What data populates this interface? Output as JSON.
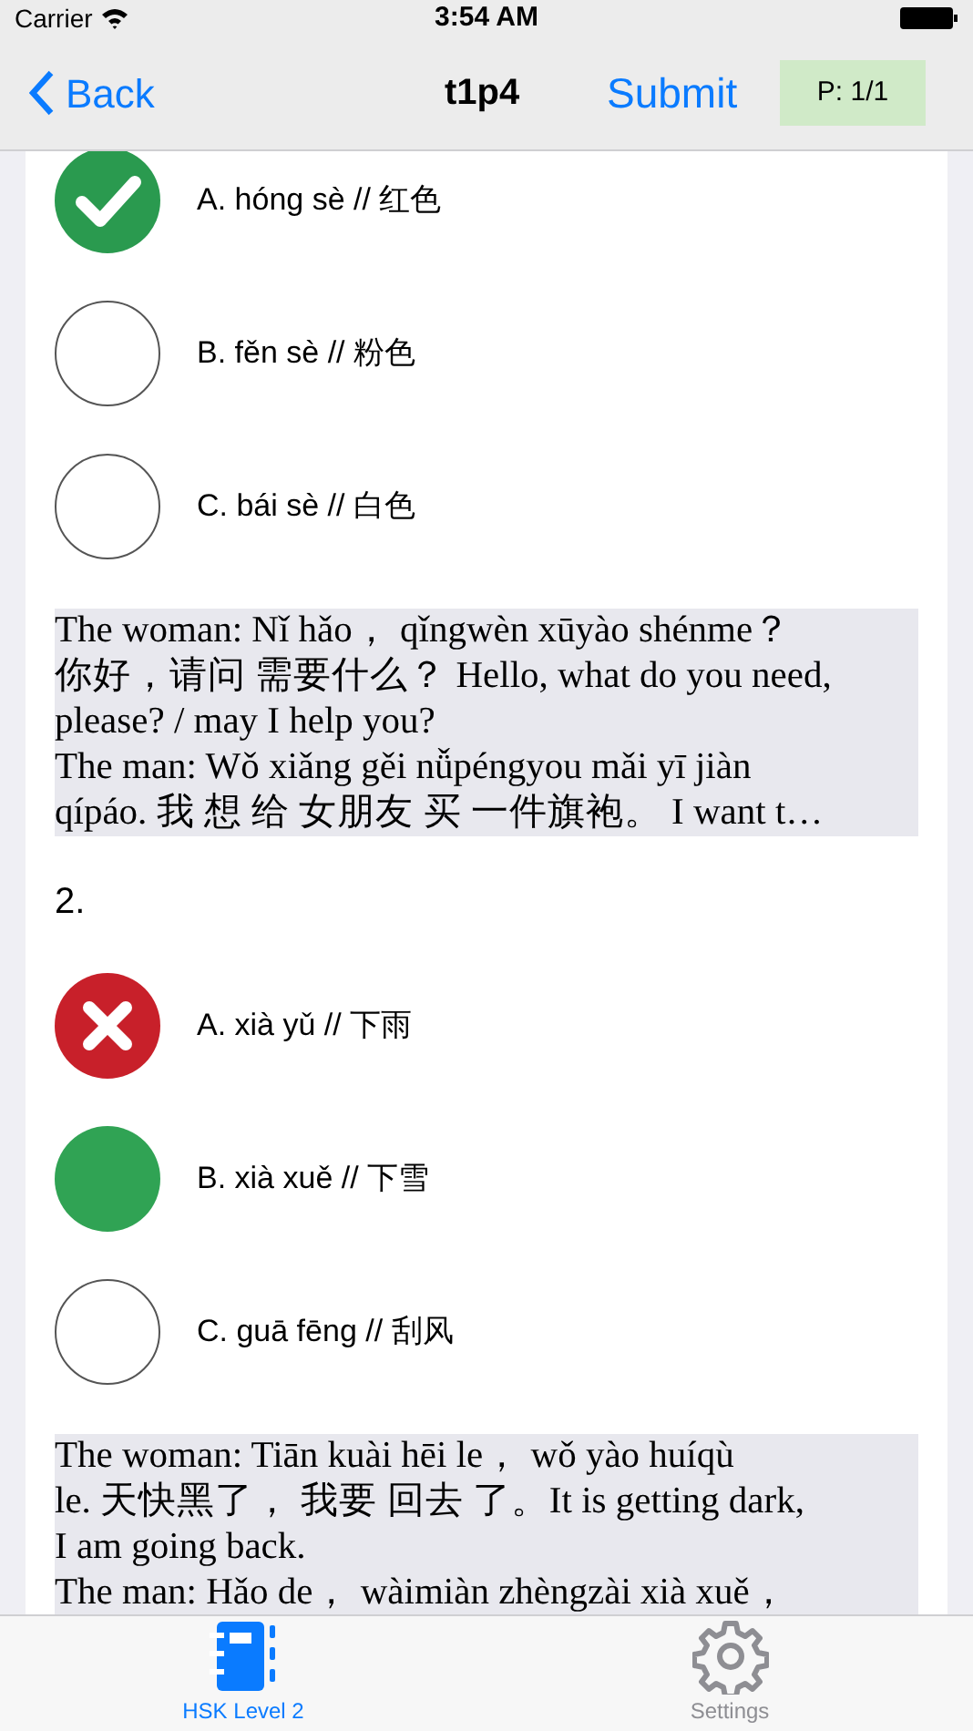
{
  "status_bar": {
    "carrier": "Carrier",
    "time": "3:54 AM"
  },
  "nav": {
    "back": "Back",
    "title": "t1p4",
    "submit": "Submit",
    "page": "P: 1/1"
  },
  "questions": [
    {
      "options": [
        {
          "label": "A. hóng sè // 红色",
          "kind": "correct"
        },
        {
          "label": "B. fěn sè // 粉色",
          "kind": "empty"
        },
        {
          "label": "C. bái sè // 白色",
          "kind": "empty"
        }
      ],
      "transcript_lines": [
        "The woman: Nǐ hǎo， qǐngwèn xūyào shénme？",
        "你好，请问 需要什么？ Hello, what do you need,",
        "please? / may I help you?",
        "The man: Wǒ xiǎng gěi nǚpéngyou mǎi yī jiàn",
        "qípáo. 我 想 给 女朋友 买 一件旗袍。 I want t…"
      ]
    },
    {
      "number": "2.",
      "options": [
        {
          "label": "A. xià yǔ // 下雨",
          "kind": "wrong"
        },
        {
          "label": "B. xià xuě // 下雪",
          "kind": "chosen"
        },
        {
          "label": "C. guā fēng // 刮风",
          "kind": "empty"
        }
      ],
      "transcript_lines": [
        "The woman: Tiān kuài hēi le， wǒ yào huíqù",
        "le. 天快黑了， 我要 回去 了。It is getting dark,",
        "I am going back.",
        "The man: Hǎo de， wàimiàn zhèngzài xià xuě，"
      ]
    }
  ],
  "tabs": [
    {
      "label": "HSK Level 2",
      "selected": true
    },
    {
      "label": "Settings",
      "selected": false
    }
  ]
}
